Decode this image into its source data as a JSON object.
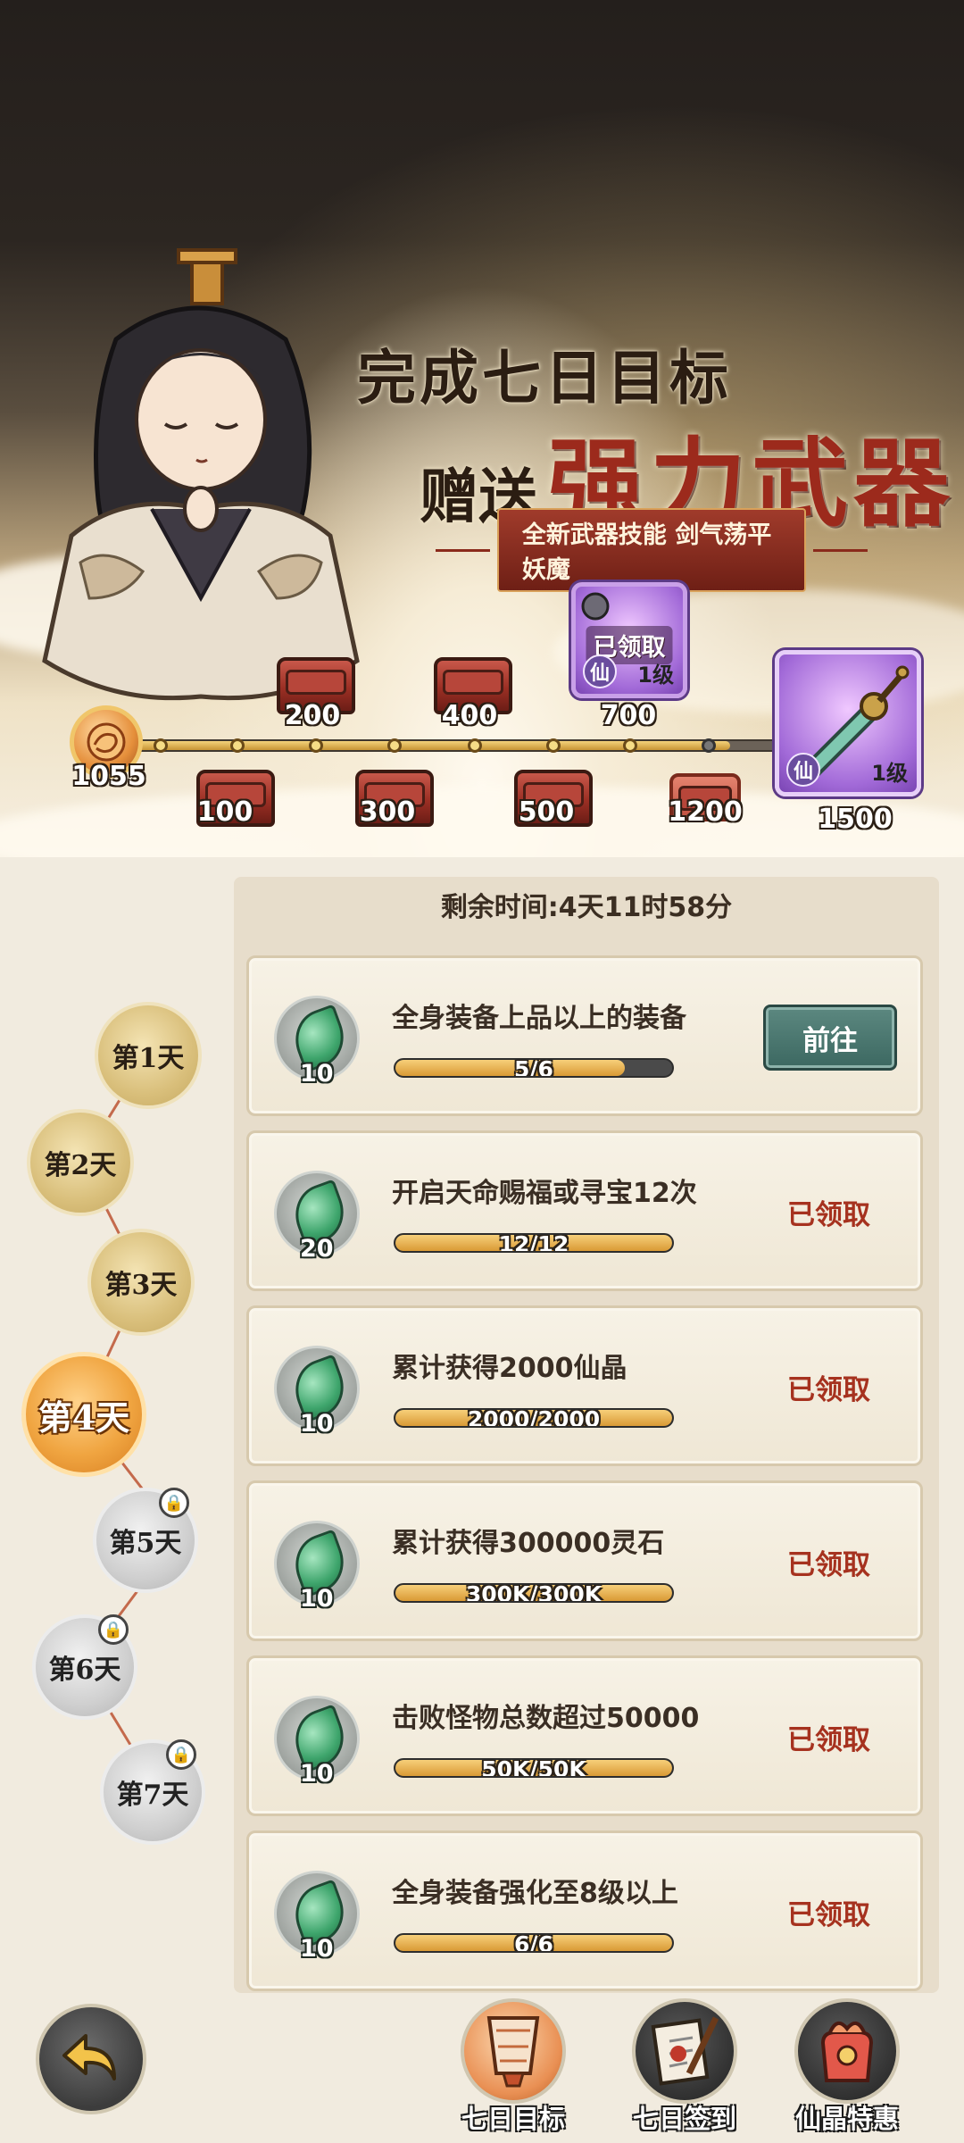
{
  "banner": {
    "line1": "完成七日目标",
    "line2_pre": "赠送",
    "line2_big": "强力武器",
    "subtitle": "全新武器技能 剑气荡平妖魔"
  },
  "progress": {
    "current_score": "1055",
    "fraction_to_end": 0.92,
    "milestones_top": [
      "200",
      "400",
      "700"
    ],
    "milestones_bottom": [
      "100",
      "300",
      "500",
      "1200"
    ],
    "final": "1500",
    "claimed_label": "已领取",
    "xian_label": "仙",
    "level_label": "1级"
  },
  "timer": {
    "text": "剩余时间:4天11时58分"
  },
  "days": [
    {
      "label": "第1天",
      "state": "done"
    },
    {
      "label": "第2天",
      "state": "done"
    },
    {
      "label": "第3天",
      "state": "done"
    },
    {
      "label": "第4天",
      "state": "active"
    },
    {
      "label": "第5天",
      "state": "locked"
    },
    {
      "label": "第6天",
      "state": "locked"
    },
    {
      "label": "第7天",
      "state": "locked"
    }
  ],
  "tasks": [
    {
      "title": "全身装备上品以上的装备",
      "reward": "10",
      "progress": "5/6",
      "fraction": 0.83,
      "action": "前往",
      "claimed": false
    },
    {
      "title": "开启天命赐福或寻宝12次",
      "reward": "20",
      "progress": "12/12",
      "fraction": 1.0,
      "action": "已领取",
      "claimed": true
    },
    {
      "title": "累计获得2000仙晶",
      "reward": "10",
      "progress": "2000/2000",
      "fraction": 1.0,
      "action": "已领取",
      "claimed": true
    },
    {
      "title": "累计获得300000灵石",
      "reward": "10",
      "progress": "300K/300K",
      "fraction": 1.0,
      "action": "已领取",
      "claimed": true
    },
    {
      "title": "击败怪物总数超过50000",
      "reward": "10",
      "progress": "50K/50K",
      "fraction": 1.0,
      "action": "已领取",
      "claimed": true
    },
    {
      "title": "全身装备强化至8级以上",
      "reward": "10",
      "progress": "6/6",
      "fraction": 1.0,
      "action": "已领取",
      "claimed": true
    }
  ],
  "bottom_nav": [
    {
      "label": "七日目标",
      "icon": "lantern-icon",
      "active": true
    },
    {
      "label": "七日签到",
      "icon": "scroll-brush-icon",
      "active": false
    },
    {
      "label": "仙晶特惠",
      "icon": "gift-bag-icon",
      "active": false
    }
  ],
  "colors": {
    "claimed": "#a6321f",
    "go_button": "#4b7a72",
    "active_day": "#f0a541",
    "bar_fill": "#e0a744"
  }
}
